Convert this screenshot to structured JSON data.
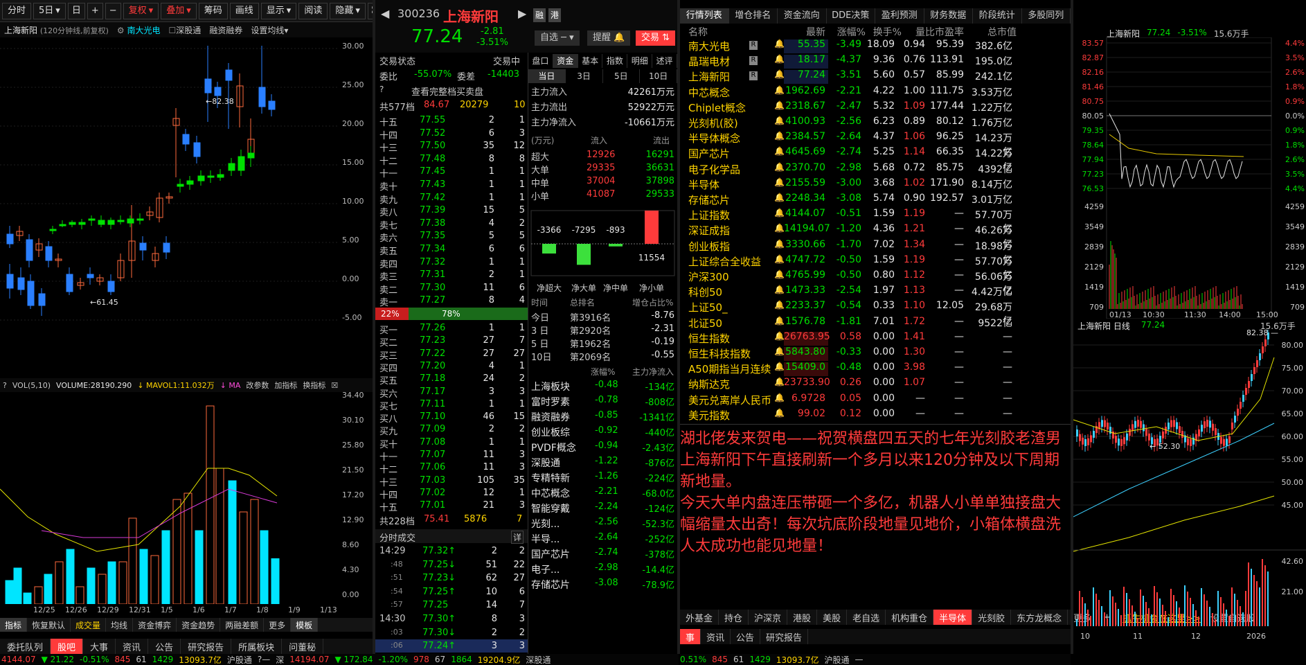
{
  "toolbar": [
    "分时",
    "5日",
    "日",
    "复权",
    "叠加",
    "筹码",
    "画线",
    "显示",
    "阅读",
    "隐藏"
  ],
  "panel_sub": {
    "name": "上海新阳",
    "mode": "(120分钟线,前复权)",
    "cmp": "南大光电",
    "a": "深股通",
    "b": "融资融券",
    "c": "设置均线"
  },
  "price_axis": [
    "30.00",
    "25.00",
    "20.00",
    "15.00",
    "10.00",
    "5.00",
    "0.00",
    "-5.00"
  ],
  "markers": {
    "high": "82.38",
    "low": "61.45"
  },
  "vol_header": {
    "vol": "VOL(5,10)",
    "volume": "VOLUME:28190.290",
    "ma1": "MAVOL1:11.032万",
    "ma": "MA",
    "param": "改参数",
    "add": "加指标",
    "swap": "换指标"
  },
  "vol_axis": [
    "34.40",
    "30.10",
    "25.80",
    "21.50",
    "17.20",
    "12.90",
    "8.60",
    "4.30",
    "0.00"
  ],
  "date_axis": [
    "12/25",
    "12/26",
    "12/29",
    "12/31",
    "1/5",
    "1/6",
    "1/7",
    "1/8",
    "1/9",
    "1/13"
  ],
  "bottom_tabs1": [
    "指标",
    "恢复默认",
    "成交量",
    "均线",
    "资金博弈",
    "资金趋势",
    "两融差额",
    "更多",
    "模板"
  ],
  "bottom_tabs2": [
    "委托队列",
    "股吧",
    "大事",
    "资讯",
    "公告",
    "研究报告",
    "所属板块",
    "问董秘"
  ],
  "status": {
    "sh_val": "4144.07",
    "sh_chg": "▼ 21.22",
    "sh_pct": "-0.51%",
    "sh_a": "845",
    "sh_b": "61",
    "sh_c": "1429",
    "sh_amt": "13093.7亿",
    "sh_name": "沪股通",
    "sz_name": "深",
    "sz_val": "14194.07",
    "sz_chg": "▼ 172.84",
    "sz_pct": "-1.20%",
    "sz_a": "978",
    "sz_b": "67",
    "sz_c": "1864",
    "sz_amt": "19204.9亿",
    "sz2": "深股通"
  },
  "quote": {
    "code": "300236",
    "name": "上海新阳",
    "price": "77.24",
    "chg": "-2.81",
    "pct": "-3.51%",
    "b1": "融",
    "b2": "港",
    "w1": "自选",
    "w2": "提醒",
    "w3": "交易"
  },
  "trade_info": {
    "state_l": "交易状态",
    "state_v": "交易中",
    "wb_l": "委比",
    "wb_v": "-55.07%",
    "wc_l": "委差",
    "wc_v": "-14403",
    "full": "查看完整档买卖盘",
    "tot_l": "共577档",
    "tot_p": "84.67",
    "tot_v": "20279",
    "tot_c": "10"
  },
  "sell_rows": [
    [
      "十五",
      "77.55",
      "2",
      "1"
    ],
    [
      "十四",
      "77.52",
      "6",
      "3"
    ],
    [
      "十三",
      "77.50",
      "35",
      "12"
    ],
    [
      "十二",
      "77.48",
      "8",
      "8"
    ],
    [
      "十一",
      "77.45",
      "1",
      "1"
    ],
    [
      "卖十",
      "77.43",
      "1",
      "1"
    ],
    [
      "卖九",
      "77.42",
      "1",
      "1"
    ],
    [
      "卖八",
      "77.39",
      "15",
      "5"
    ],
    [
      "卖七",
      "77.38",
      "4",
      "2"
    ],
    [
      "卖六",
      "77.35",
      "5",
      "5"
    ],
    [
      "卖五",
      "77.34",
      "6",
      "6"
    ],
    [
      "卖四",
      "77.32",
      "1",
      "1"
    ],
    [
      "卖三",
      "77.31",
      "2",
      "1"
    ],
    [
      "卖二",
      "77.30",
      "11",
      "6"
    ],
    [
      "卖一",
      "77.27",
      "8",
      "4"
    ]
  ],
  "ratio": {
    "l": "22%",
    "r": "78%"
  },
  "buy_rows": [
    [
      "买一",
      "77.26",
      "1",
      "1"
    ],
    [
      "买二",
      "77.23",
      "27",
      "7"
    ],
    [
      "买三",
      "77.22",
      "27",
      "27"
    ],
    [
      "买四",
      "77.20",
      "4",
      "1"
    ],
    [
      "买五",
      "77.18",
      "24",
      "2"
    ],
    [
      "买六",
      "77.17",
      "3",
      "3"
    ],
    [
      "买七",
      "77.11",
      "1",
      "1"
    ],
    [
      "买八",
      "77.10",
      "46",
      "15"
    ],
    [
      "买九",
      "77.09",
      "2",
      "2"
    ],
    [
      "买十",
      "77.08",
      "1",
      "1"
    ],
    [
      "十一",
      "77.07",
      "11",
      "3"
    ],
    [
      "十二",
      "77.06",
      "11",
      "3"
    ],
    [
      "十三",
      "77.03",
      "105",
      "35"
    ],
    [
      "十四",
      "77.02",
      "12",
      "1"
    ],
    [
      "十五",
      "77.01",
      "21",
      "3"
    ]
  ],
  "buy_total": {
    "l": "共228档",
    "p": "75.41",
    "v": "5876",
    "c": "7"
  },
  "ticks_title": "分时成交",
  "ticks_detail": "详",
  "ticks": [
    [
      "14:29",
      "77.32",
      "2",
      "2"
    ],
    [
      ":48",
      "77.25",
      "51",
      "22"
    ],
    [
      ":51",
      "77.23",
      "62",
      "27"
    ],
    [
      ":54",
      "77.25",
      "10",
      "6"
    ],
    [
      ":57",
      "77.25",
      "14",
      "7"
    ],
    [
      "14:30",
      "77.30",
      "8",
      "3"
    ],
    [
      ":03",
      "77.30",
      "2",
      "2"
    ],
    [
      ":06",
      "77.24",
      "3",
      "3"
    ]
  ],
  "fund_tabs": [
    "盘口",
    "资金",
    "基本",
    "指数",
    "明细",
    "述评"
  ],
  "fund_sub": [
    "当日",
    "3日",
    "5日",
    "10日"
  ],
  "fund_flow": [
    [
      "主力流入",
      "42261万元"
    ],
    [
      "主力流出",
      "52922万元"
    ],
    [
      "主力净流入",
      "-10661万元"
    ]
  ],
  "fund_table_head": [
    "(万元)",
    "流入",
    "流出"
  ],
  "fund_table": [
    [
      "超大",
      "12926",
      "16291"
    ],
    [
      "大单",
      "29335",
      "36631"
    ],
    [
      "中单",
      "37004",
      "37898"
    ],
    [
      "小单",
      "41087",
      "29533"
    ]
  ],
  "net_bars": {
    "v": [
      "-3366",
      "-7295",
      "-893",
      "11554"
    ],
    "l": [
      "净超大",
      "净大单",
      "净中单",
      "净小单"
    ]
  },
  "rank_head": [
    "时间",
    "总排名",
    "增仓占比%"
  ],
  "rank": [
    [
      "今日",
      "第3916名",
      "-8.76"
    ],
    [
      "3 日",
      "第2920名",
      "-2.31"
    ],
    [
      "5 日",
      "第1962名",
      "-0.19"
    ],
    [
      "10日",
      "第2069名",
      "-0.55"
    ]
  ],
  "sector_head": [
    "",
    "涨幅%",
    "主力净流入"
  ],
  "sectors": [
    [
      "上海板块",
      "-0.48",
      "-134亿"
    ],
    [
      "富时罗素",
      "-0.78",
      "-808亿"
    ],
    [
      "融资融券",
      "-0.85",
      "-1341亿"
    ],
    [
      "创业板综",
      "-0.92",
      "-440亿"
    ],
    [
      "PVDF概念",
      "-0.94",
      "-2.43亿"
    ],
    [
      "深股通",
      "-1.22",
      "-876亿"
    ],
    [
      "专精特新",
      "-1.26",
      "-224亿"
    ],
    [
      "中芯概念",
      "-2.21",
      "-68.0亿"
    ],
    [
      "智能穿戴",
      "-2.24",
      "-124亿"
    ],
    [
      "光刻...",
      "-2.56",
      "-52.3亿"
    ],
    [
      "半导...",
      "-2.64",
      "-252亿"
    ],
    [
      "国产芯片",
      "-2.74",
      "-378亿"
    ],
    [
      "电子...",
      "-2.98",
      "-14.4亿"
    ],
    [
      "存储芯片",
      "-3.08",
      "-78.9亿"
    ]
  ],
  "mk_tabs": [
    "行情列表",
    "增仓排名",
    "资金流向",
    "DDE决策",
    "盈利预测",
    "财务数据",
    "阶段统计",
    "多股同列"
  ],
  "mk_head": [
    "名称",
    "最新",
    "涨幅%",
    "换手%",
    "量比",
    "市盈率",
    "总市值"
  ],
  "mk_rows": [
    [
      "南大光电",
      "55.35",
      "-3.49",
      "18.09",
      "0.94",
      "95.39",
      "382.6亿"
    ],
    [
      "晶瑞电材",
      "18.17",
      "-4.37",
      "9.36",
      "0.76",
      "113.91",
      "195.0亿"
    ],
    [
      "上海新阳",
      "77.24",
      "-3.51",
      "5.60",
      "0.57",
      "85.99",
      "242.1亿"
    ],
    [
      "中芯概念",
      "1962.69",
      "-2.21",
      "4.22",
      "1.00",
      "111.75",
      "3.53万亿"
    ],
    [
      "Chiplet概念",
      "2318.67",
      "-2.47",
      "5.32",
      "1.09",
      "177.44",
      "1.22万亿"
    ],
    [
      "光刻机(胶)",
      "4100.93",
      "-2.56",
      "6.23",
      "0.89",
      "80.12",
      "1.76万亿"
    ],
    [
      "半导体概念",
      "2384.57",
      "-2.64",
      "4.37",
      "1.06",
      "96.25",
      "14.23万亿"
    ],
    [
      "国产芯片",
      "4645.69",
      "-2.74",
      "5.25",
      "1.14",
      "66.35",
      "14.22万亿"
    ],
    [
      "电子化学品",
      "2370.70",
      "-2.98",
      "5.68",
      "0.72",
      "85.75",
      "4392亿"
    ],
    [
      "半导体",
      "2155.59",
      "-3.00",
      "3.68",
      "1.02",
      "171.90",
      "8.14万亿"
    ],
    [
      "存储芯片",
      "2248.34",
      "-3.08",
      "5.74",
      "0.90",
      "192.57",
      "3.01万亿"
    ],
    [
      "上证指数",
      "4144.07",
      "-0.51",
      "1.59",
      "1.19",
      "—",
      "57.70万亿"
    ],
    [
      "深证成指",
      "14194.07",
      "-1.20",
      "4.36",
      "1.21",
      "—",
      "46.26万亿"
    ],
    [
      "创业板指",
      "3330.66",
      "-1.70",
      "7.02",
      "1.34",
      "—",
      "18.98万亿"
    ],
    [
      "上证综合全收益",
      "4747.72",
      "-0.50",
      "1.59",
      "1.19",
      "—",
      "57.70万亿"
    ],
    [
      "沪深300",
      "4765.99",
      "-0.50",
      "0.80",
      "1.12",
      "—",
      "56.06万亿"
    ],
    [
      "科创50",
      "1473.33",
      "-2.54",
      "1.97",
      "1.13",
      "—",
      "4.42万亿"
    ],
    [
      "上证50_",
      "2233.37",
      "-0.54",
      "0.33",
      "1.10",
      "12.05",
      "29.68万亿"
    ],
    [
      "北证50",
      "1576.78",
      "-1.81",
      "7.01",
      "1.72",
      "—",
      "9522亿"
    ],
    [
      "恒生指数",
      "26763.95",
      "0.58",
      "0.00",
      "1.41",
      "—",
      "—"
    ],
    [
      "恒生科技指数",
      "5843.80",
      "-0.33",
      "0.00",
      "1.30",
      "—",
      "—"
    ],
    [
      "A50期指当月连续",
      "15409.0",
      "-0.48",
      "0.00",
      "3.98",
      "—",
      "—"
    ],
    [
      "纳斯达克",
      "23733.90",
      "0.26",
      "0.00",
      "1.07",
      "—",
      "—"
    ],
    [
      "美元兑离岸人民币",
      "6.9728",
      "0.05",
      "0.00",
      "—",
      "—",
      "—"
    ],
    [
      "美元指数",
      "99.02",
      "0.12",
      "0.00",
      "—",
      "—",
      "—"
    ]
  ],
  "post": {
    "p1": "湖北佬发来贺电——祝贺横盘四五天的七年光刻胶老渣男上海新阳下午直接刷新一个多月以来120分钟及以下周期新地量。",
    "p2": "今天大单内盘连压带砸一个多亿，机器人小单单独接盘大幅缩量太出奇！每次坑底阶段地量见地价，小箱体横盘洗人太成功也能见地量！"
  },
  "mk_bottom_tabs": [
    "外基金",
    "持仓",
    "沪深京",
    "港股",
    "美股",
    "老自选",
    "机构重仓",
    "半导体",
    "光刻胶",
    "东方龙概念",
    "更多",
    "+"
  ],
  "mk_bottom_link": "抓牛机会在这里>>",
  "mk_bottom_set": "设置自选股",
  "mk_bottom2": [
    "事",
    "资讯",
    "公告",
    "研究报告"
  ],
  "status_r": {
    "pct": "0.51%",
    "a": "845",
    "b": "61",
    "c": "1429",
    "amt": "13093.7亿",
    "name": "沪股通",
    "dash": "—",
    "sz": "深",
    "val": "14194.07",
    "chg": "▼ 172.84",
    "pct2": "-1.20%",
    "a2": "978",
    "b2": "67",
    "c2": "1864",
    "amt2": "19204.9亿",
    "name2": "深股通"
  },
  "mini": {
    "name": "上海新阳",
    "price": "77.24",
    "pct": "-3.51%",
    "vol": "15.6万手",
    "y": [
      "83.57",
      "82.87",
      "82.16",
      "81.46",
      "80.75",
      "80.05",
      "79.35",
      "78.64",
      "77.94",
      "77.23",
      "76.53"
    ],
    "yr": [
      "4.4%",
      "3.5%",
      "2.6%",
      "1.8%",
      "0.9%",
      "0.0%",
      "0.9%",
      "1.8%",
      "2.6%",
      "3.5%",
      "4.4%"
    ],
    "vy": [
      "4259",
      "3549",
      "2839",
      "2129",
      "1419",
      "709"
    ],
    "vyr": [
      "4259",
      "3549",
      "2839",
      "2129",
      "1419",
      "709"
    ],
    "x": [
      "01/13",
      "10:30",
      "11:30",
      "14:00",
      "15:00"
    ]
  },
  "daily": {
    "name": "上海新阳 日线",
    "price": "77.24",
    "vol": "15.6万手",
    "hi": "82.38",
    "lo": "52.30",
    "y": [
      "80.00",
      "75.00",
      "70.00",
      "65.00",
      "60.00",
      "55.00",
      "50.00",
      "45.00"
    ],
    "vy": [
      "42.60",
      "21.00"
    ],
    "x": [
      "10",
      "11",
      "12",
      "2026"
    ]
  }
}
